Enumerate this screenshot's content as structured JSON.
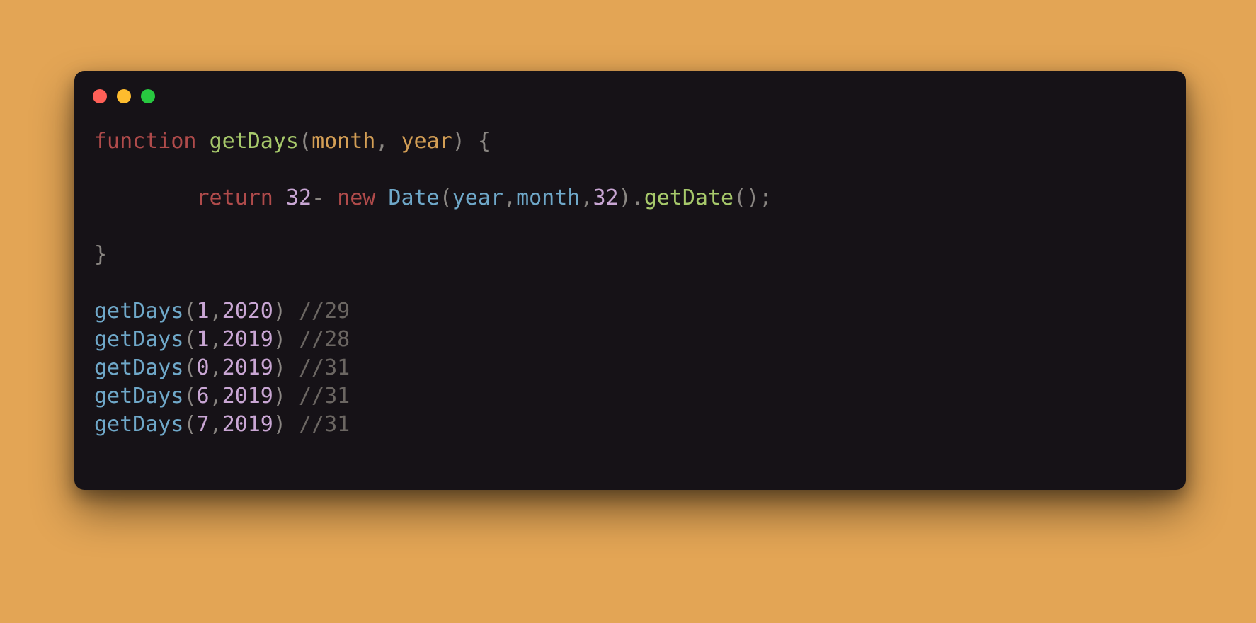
{
  "code": {
    "l1": {
      "kw": "function",
      "sp": " ",
      "fn": "getDays",
      "lp": "(",
      "arg1": "month",
      "comma": ", ",
      "arg2": "year",
      "rp": ")",
      "sp2": " ",
      "lb": "{"
    },
    "l2": {
      "indent": "        ",
      "kw": "return",
      "sp": " ",
      "n32": "32",
      "dash": "- ",
      "new": "new",
      "sp2": " ",
      "date": "Date",
      "lp": "(",
      "a1": "year",
      "c1": ",",
      "a2": "month",
      "c2": ",",
      "n32b": "32",
      "rp": ")",
      "dot": ".",
      "gdate": "getDate",
      "lp2": "(",
      "rp2": ")",
      "semi": ";"
    },
    "l3": {
      "rb": "}"
    },
    "calls": [
      {
        "fn": "getDays",
        "lp": "(",
        "n1": "1",
        "c": ",",
        "n2": "2020",
        "rp": ")",
        "sp": " ",
        "cmt": "//29"
      },
      {
        "fn": "getDays",
        "lp": "(",
        "n1": "1",
        "c": ",",
        "n2": "2019",
        "rp": ")",
        "sp": " ",
        "cmt": "//28"
      },
      {
        "fn": "getDays",
        "lp": "(",
        "n1": "0",
        "c": ",",
        "n2": "2019",
        "rp": ")",
        "sp": " ",
        "cmt": "//31"
      },
      {
        "fn": "getDays",
        "lp": "(",
        "n1": "6",
        "c": ",",
        "n2": "2019",
        "rp": ")",
        "sp": " ",
        "cmt": "//31"
      },
      {
        "fn": "getDays",
        "lp": "(",
        "n1": "7",
        "c": ",",
        "n2": "2019",
        "rp": ")",
        "sp": " ",
        "cmt": "//31"
      }
    ]
  }
}
